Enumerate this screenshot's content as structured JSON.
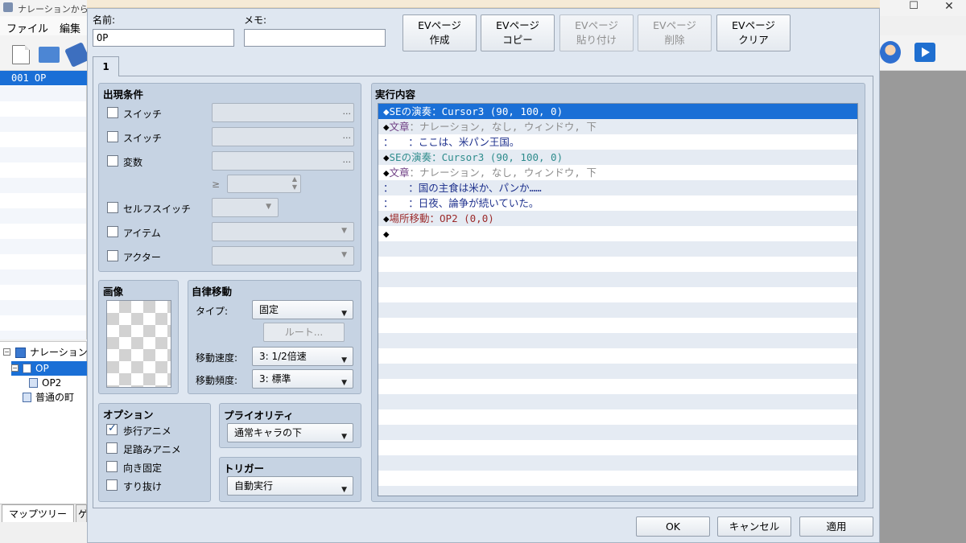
{
  "app": {
    "title": "ナレーションから始まる",
    "menu": [
      "ファイル",
      "編集"
    ]
  },
  "event_list": {
    "selected": "001  OP"
  },
  "map_tree": {
    "root": "ナレーション",
    "items": [
      "OP",
      "OP2",
      "普通の町"
    ],
    "tabs": [
      "マップツリー",
      "ゲ"
    ]
  },
  "dialog": {
    "name_label": "名前:",
    "name_value": "OP",
    "memo_label": "メモ:",
    "memo_value": "",
    "buttons": [
      {
        "line1": "EVページ",
        "line2": "作成",
        "enabled": true
      },
      {
        "line1": "EVページ",
        "line2": "コピー",
        "enabled": true
      },
      {
        "line1": "EVページ",
        "line2": "貼り付け",
        "enabled": false
      },
      {
        "line1": "EVページ",
        "line2": "削除",
        "enabled": false
      },
      {
        "line1": "EVページ",
        "line2": "クリア",
        "enabled": true
      }
    ],
    "page_tab": "1",
    "conditions": {
      "title": "出現条件",
      "switch1": "スイッチ",
      "switch2": "スイッチ",
      "variable": "変数",
      "ge": "≥",
      "self_switch": "セルフスイッチ",
      "item": "アイテム",
      "actor": "アクター",
      "ellipsis": "..."
    },
    "image": {
      "title": "画像"
    },
    "autonomous": {
      "title": "自律移動",
      "type_label": "タイプ:",
      "type_value": "固定",
      "route_button": "ルート...",
      "speed_label": "移動速度:",
      "speed_value": "3: 1/2倍速",
      "freq_label": "移動頻度:",
      "freq_value": "3: 標準"
    },
    "options": {
      "title": "オプション",
      "walk_anim": "歩行アニメ",
      "walk_anim_checked": true,
      "step_anim": "足踏みアニメ",
      "dir_fix": "向き固定",
      "through": "すり抜け"
    },
    "priority": {
      "title": "プライオリティ",
      "value": "通常キャラの下"
    },
    "trigger": {
      "title": "トリガー",
      "value": "自動実行"
    },
    "contents": {
      "title": "実行内容",
      "commands": [
        {
          "parts": [
            {
              "t": "◆SEの演奏：Cursor3 (90, 100, 0)",
              "c": ""
            }
          ],
          "selected": true
        },
        {
          "parts": [
            {
              "t": "◆",
              "c": ""
            },
            {
              "t": "文章",
              "c": "c-kw"
            },
            {
              "t": "：ナレーション, なし, ウィンドウ, 下",
              "c": "c-gray"
            }
          ]
        },
        {
          "parts": [
            {
              "t": "：　　：ここは、米パン王国。",
              "c": "c-navy"
            }
          ]
        },
        {
          "parts": [
            {
              "t": "◆",
              "c": ""
            },
            {
              "t": "SEの演奏：Cursor3 (90, 100, 0)",
              "c": "c-teal"
            }
          ]
        },
        {
          "parts": [
            {
              "t": "◆",
              "c": ""
            },
            {
              "t": "文章",
              "c": "c-kw"
            },
            {
              "t": "：ナレーション, なし, ウィンドウ, 下",
              "c": "c-gray"
            }
          ]
        },
        {
          "parts": [
            {
              "t": "：　　：国の主食は米か、パンか……",
              "c": "c-navy"
            }
          ]
        },
        {
          "parts": [
            {
              "t": "：　　：日夜、論争が続いていた。",
              "c": "c-navy"
            }
          ]
        },
        {
          "parts": [
            {
              "t": "◆",
              "c": ""
            },
            {
              "t": "場所移動：OP2 (0,0)",
              "c": "c-red"
            }
          ]
        },
        {
          "parts": [
            {
              "t": "◆",
              "c": ""
            }
          ]
        }
      ]
    },
    "footer": {
      "ok": "OK",
      "cancel": "キャンセル",
      "apply": "適用"
    }
  },
  "colors": {
    "selection": "#1a6fd6",
    "dialog_bg": "#dfe7f1",
    "group_bg": "#c6d3e3"
  }
}
